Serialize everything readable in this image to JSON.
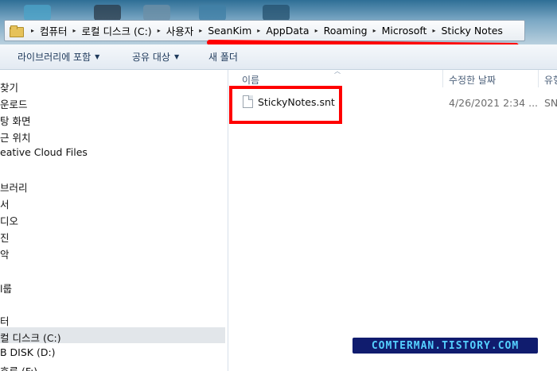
{
  "address_bar": {
    "breadcrumbs": [
      "컴퓨터",
      "로컬 디스크 (C:)",
      "사용자",
      "SeanKim",
      "AppData",
      "Roaming",
      "Microsoft",
      "Sticky Notes"
    ],
    "separator": "▸"
  },
  "toolbar": {
    "include_library": "라이브러리에 포함",
    "share_with": "공유 대상",
    "new_folder": "새 폴더",
    "caret": "▼"
  },
  "nav_pane": {
    "items": [
      "찾기",
      "운로드",
      "탕 화면",
      "근 위치",
      "eative Cloud Files",
      "브러리",
      "서",
      "디오",
      "진",
      "악",
      "l룹",
      "터",
      "컬 디스크 (C:)",
      "B DISK (D:)",
      "호류 (F:)"
    ]
  },
  "file_list": {
    "columns": [
      "이름",
      "수정한 날짜",
      "유형"
    ],
    "files": [
      {
        "name": "StickyNotes.snt",
        "date": "4/26/2021 2:34 ...",
        "type": "SN"
      }
    ]
  },
  "watermark": {
    "text": "COMTERMAN.TISTORY.COM"
  },
  "colors": {
    "highlight": "#ff0000",
    "watermark_bg": "#101c6e",
    "watermark_text": "#55d0ff"
  }
}
